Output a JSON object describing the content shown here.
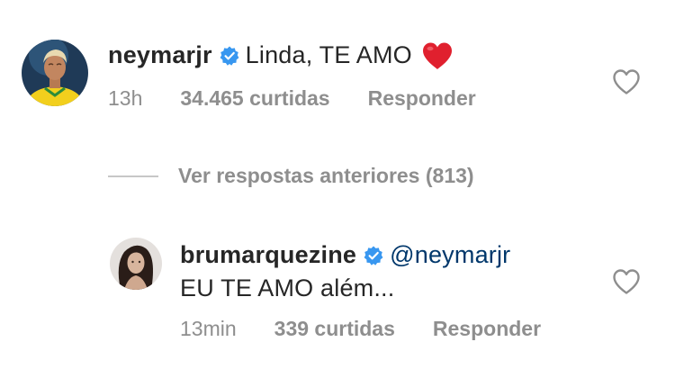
{
  "main_comment": {
    "avatar_icon": "profile-photo-neymarjr",
    "username": "neymarjr",
    "verified_icon": "verified-badge-icon",
    "text": "Linda, TE AMO",
    "emoji": "red-heart-emoji",
    "time": "13h",
    "likes": "34.465 curtidas",
    "reply_label": "Responder",
    "like_icon": "heart-outline-icon"
  },
  "view_replies": {
    "label": "Ver respostas anteriores (813)"
  },
  "reply_comment": {
    "avatar_icon": "profile-photo-brumarquezine",
    "username": "brumarquezine",
    "verified_icon": "verified-badge-icon",
    "mention": "@neymarjr",
    "text": "EU TE AMO além...",
    "time": "13min",
    "likes": "339 curtidas",
    "reply_label": "Responder",
    "like_icon": "heart-outline-icon"
  },
  "colors": {
    "text": "#262626",
    "secondary": "#8e8e8e",
    "mention": "#00376b",
    "verified": "#3897f0",
    "emoji_heart": "#e0202e",
    "divider": "#c7c7c7"
  }
}
